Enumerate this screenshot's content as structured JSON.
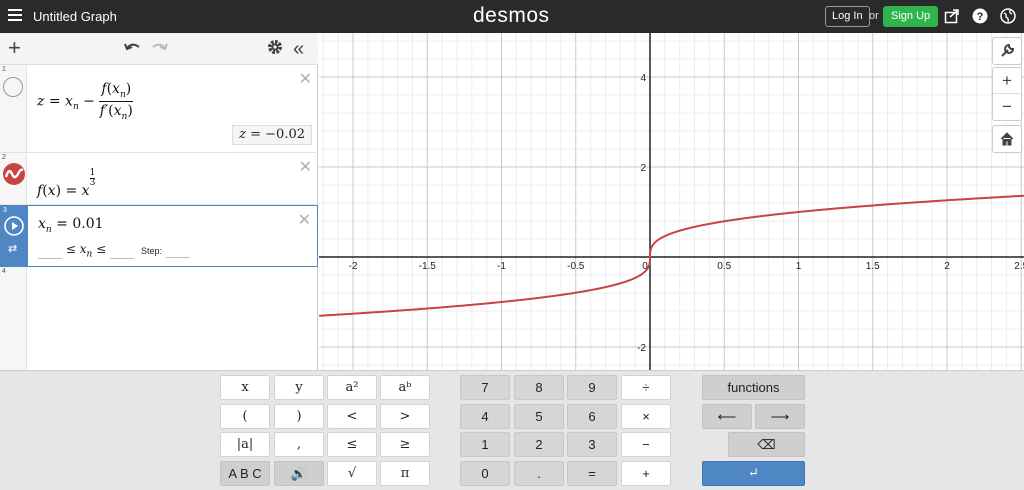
{
  "header": {
    "title": "Untitled Graph",
    "logo": "desmos",
    "login_label": "Log In",
    "or_text": "or",
    "signup_label": "Sign Up",
    "signup_color": "#2fb54e"
  },
  "expressions": [
    {
      "index": "1",
      "lhs": "z",
      "x_var": "x",
      "sub_n": "n",
      "f": "f",
      "fprime": "f′",
      "result_var": "z",
      "result_value": "−0.02"
    },
    {
      "index": "2",
      "f": "f",
      "x": "x",
      "base": "x",
      "exp_num": "1",
      "exp_den": "3",
      "curve_color": "#c74440"
    },
    {
      "index": "3",
      "var": "x",
      "sub": "n",
      "value": "0.01",
      "step_label": "Step:"
    },
    {
      "index": "4"
    }
  ],
  "graph": {
    "x_ticks": [
      "-2",
      "-1.5",
      "-1",
      "-0.5",
      "0",
      "0.5",
      "1",
      "1.5",
      "2",
      "2.5"
    ],
    "y_ticks": [
      "4",
      "2",
      "-2"
    ],
    "grid": true
  },
  "keypad": {
    "func_keys": [
      [
        "x",
        "y",
        "a²",
        "aᵇ"
      ],
      [
        "(",
        ")",
        "<",
        ">"
      ],
      [
        "|a|",
        ",",
        "≤",
        "≥"
      ],
      [
        "A B C",
        "🔊",
        "√",
        "π"
      ]
    ],
    "num_keys": [
      [
        "7",
        "8",
        "9",
        "÷"
      ],
      [
        "4",
        "5",
        "6",
        "×"
      ],
      [
        "1",
        "2",
        "3",
        "−"
      ],
      [
        "0",
        ".",
        "=",
        "+"
      ]
    ],
    "functions_label": "functions",
    "left_arrow": "⟵",
    "right_arrow": "⟶",
    "backspace": "⌫",
    "enter": "↵"
  }
}
